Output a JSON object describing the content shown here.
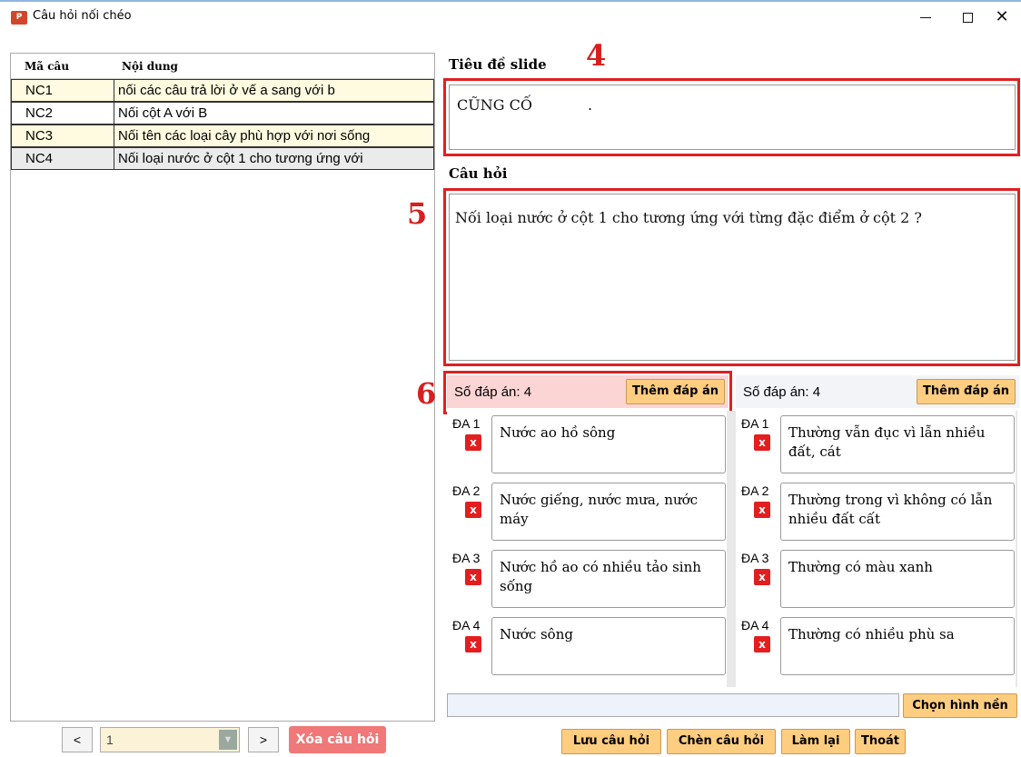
{
  "window": {
    "title": "Câu hỏi nối chéo",
    "icon": "powerpoint-icon"
  },
  "list": {
    "headers": {
      "code": "Mã câu",
      "content": "Nội dung"
    },
    "rows": [
      {
        "code": "NC1",
        "content": "nối các câu trả lời ở vế a sang với b"
      },
      {
        "code": "NC2",
        "content": "Nối cột A với B"
      },
      {
        "code": "NC3",
        "content": "Nối tên các loại cây phù hợp với nơi sống"
      },
      {
        "code": "NC4",
        "content": "Nối loại nước ở cột 1 cho tương ứng với"
      }
    ],
    "selected_index": 3
  },
  "nav": {
    "prev": "<",
    "next": ">",
    "page": "1",
    "delete": "Xóa câu hỏi"
  },
  "slide_title": {
    "label": "Tiêu đề slide",
    "marker": "4",
    "value": "CŨNG CỐ            ."
  },
  "question": {
    "label": "Câu hỏi",
    "marker": "5",
    "value": "Nối loại nước ở cột 1 cho tương ứng với từng đặc điểm ở cột 2 ?"
  },
  "answers": {
    "marker": "6",
    "left": {
      "count_text": "Số đáp án: 4",
      "add_button": "Thêm đáp án",
      "items": [
        {
          "label": "ĐA 1",
          "text": "Nước ao hồ sông"
        },
        {
          "label": "ĐA 2",
          "text": "Nước giếng, nước mưa, nước máy"
        },
        {
          "label": "ĐA 3",
          "text": "Nước hồ ao có nhiều tảo sinh sống"
        },
        {
          "label": "ĐA 4",
          "text": "Nước sông"
        }
      ]
    },
    "right": {
      "count_text": "Số đáp án: 4",
      "add_button": "Thêm đáp án",
      "items": [
        {
          "label": "ĐA 1",
          "text": "Thường vẫn đục vì lẫn nhiều đất, cát"
        },
        {
          "label": "ĐA 2",
          "text": "Thường trong vì không có lẫn nhiều đất cất"
        },
        {
          "label": "ĐA 3",
          "text": "Thường có màu xanh"
        },
        {
          "label": "ĐA 4",
          "text": "Thường có nhiều phù sa"
        }
      ]
    },
    "remove_glyph": "x"
  },
  "background": {
    "button": "Chọn hình nền",
    "value": ""
  },
  "actions": {
    "save": "Lưu câu hỏi",
    "insert": "Chèn câu hỏi",
    "reset": "Làm lại",
    "exit": "Thoát"
  },
  "colors": {
    "highlight_red": "#e02020",
    "button_orange": "#ffcd80",
    "row_yellow": "#fffbe0",
    "delete_red": "#f07878"
  }
}
